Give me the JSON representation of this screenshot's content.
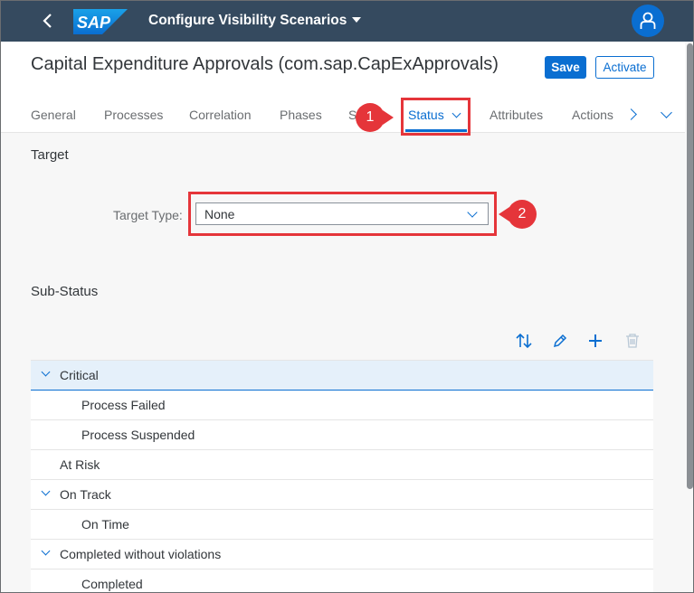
{
  "shell": {
    "app_title": "Configure Visibility Scenarios",
    "logo_text": "SAP"
  },
  "header": {
    "title": "Capital Expenditure Approvals (com.sap.CapExApprovals)",
    "save_label": "Save",
    "activate_label": "Activate"
  },
  "tabs": [
    {
      "label": "General"
    },
    {
      "label": "Processes"
    },
    {
      "label": "Correlation"
    },
    {
      "label": "Phases"
    },
    {
      "label": "St"
    },
    {
      "label": "Status"
    },
    {
      "label": "Attributes"
    },
    {
      "label": "Actions"
    }
  ],
  "callouts": [
    "1",
    "2"
  ],
  "target": {
    "section_title": "Target",
    "field_label": "Target Type:",
    "field_value": "None"
  },
  "sub_status": {
    "section_title": "Sub-Status",
    "rows": [
      {
        "label": "Critical"
      },
      {
        "label": "Process Failed"
      },
      {
        "label": "Process Suspended"
      },
      {
        "label": "At Risk"
      },
      {
        "label": "On Track"
      },
      {
        "label": "On Time"
      },
      {
        "label": "Completed without violations"
      },
      {
        "label": "Completed"
      }
    ]
  },
  "colors": {
    "shell": "#354a5f",
    "accent": "#0a6ed1",
    "callout": "#e5353a"
  }
}
